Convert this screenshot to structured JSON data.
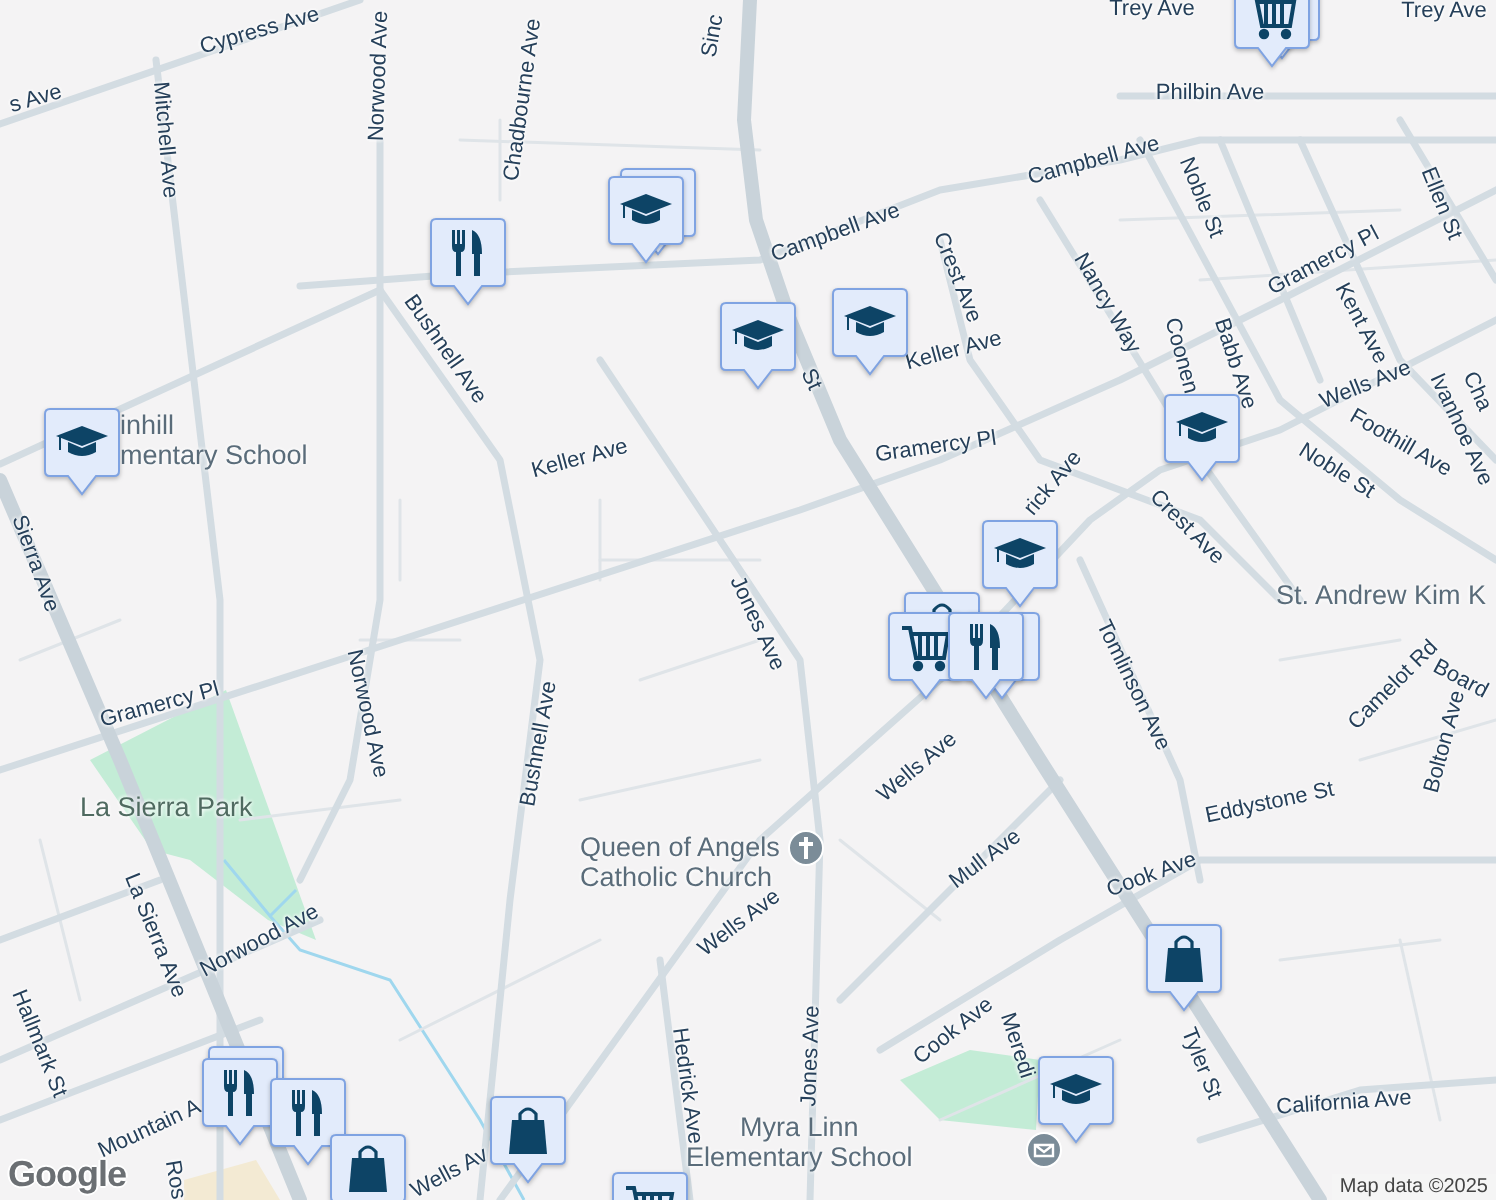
{
  "streets": [
    "Cypress Ave",
    "s Ave",
    "Norwood Ave",
    "Chadbourne Ave",
    "Mitchell Ave",
    "Sinc",
    "Trey Ave",
    "Trey Ave",
    "Philbin Ave",
    "Campbell Ave",
    "Campbell Ave",
    "Crest Ave",
    "Nancy Way",
    "Noble St",
    "Ellen St",
    "Gramercy Pl",
    "Kent Ave",
    "Coonen",
    "Babb Ave",
    "Wells Ave",
    "Foothill Ave",
    "Ivanhoe Ave",
    "Cha",
    "Noble St",
    "Crest Ave",
    "Gramercy Pl",
    "Keller Ave",
    "Keller Ave",
    "Bushnell Ave",
    "rick Ave",
    "St",
    "Jones Ave",
    "Bushnell Ave",
    "Norwood Ave",
    "Gramercy Pl",
    "Sierra Ave",
    "La Sierra Ave",
    "Norwood Ave",
    "Hallmark St",
    "Mountain A",
    "Ros",
    "Wells Av",
    "Wells Ave",
    "Wells Ave",
    "Hedrick Ave",
    "Jones Ave",
    "Mull Ave",
    "Tomlinson Ave",
    "Camelot Rd",
    "Board",
    "Bolton Ave",
    "Eddystone St",
    "Cook Ave",
    "Cook Ave",
    "Meredi",
    "Tyler St",
    "California Ave"
  ],
  "places": [
    {
      "kind": "park",
      "lines": [
        "La Sierra Park"
      ]
    },
    {
      "kind": "church",
      "lines": [
        "Queen of Angels",
        "Catholic Church"
      ]
    },
    {
      "kind": "school",
      "lines": [
        "Myra Linn",
        "Elementary School"
      ]
    },
    {
      "kind": "plain",
      "lines": [
        "St. Andrew Kim K"
      ]
    },
    {
      "kind": "plain",
      "lines": [
        "inhill",
        "mentary School"
      ]
    }
  ],
  "pins": [
    {
      "kind": "grocery"
    },
    {
      "kind": "grocery"
    },
    {
      "kind": "school"
    },
    {
      "kind": "school"
    },
    {
      "kind": "restaurant"
    },
    {
      "kind": "school"
    },
    {
      "kind": "school"
    },
    {
      "kind": "school"
    },
    {
      "kind": "school"
    },
    {
      "kind": "school"
    },
    {
      "kind": "shopping"
    },
    {
      "kind": "restaurant"
    },
    {
      "kind": "grocery"
    },
    {
      "kind": "restaurant"
    },
    {
      "kind": "restaurant"
    },
    {
      "kind": "restaurant"
    },
    {
      "kind": "restaurant"
    },
    {
      "kind": "shopping"
    },
    {
      "kind": "shopping"
    },
    {
      "kind": "grocery"
    },
    {
      "kind": "shopping"
    },
    {
      "kind": "school"
    }
  ],
  "logo": "Google",
  "attribution": "Map data ©2025"
}
